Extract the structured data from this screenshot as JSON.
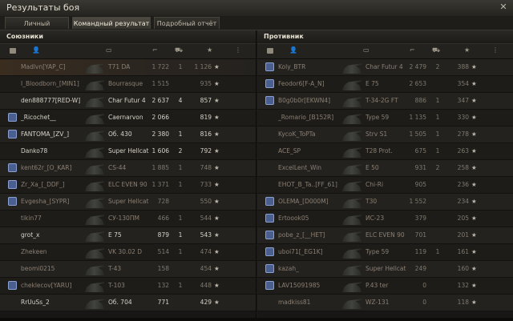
{
  "window": {
    "title": "Результаты боя",
    "close_glyph": "✕"
  },
  "tabs": [
    {
      "label": "Личный результат",
      "active": false
    },
    {
      "label": "Командный результат",
      "active": true
    },
    {
      "label": "Подробный отчёт",
      "active": false
    }
  ],
  "allies": {
    "title": "Союзники",
    "rows": [
      {
        "name": "Madlvn[YAP_C]",
        "vehicle": "T71 DA",
        "damage": "1 722",
        "kills": "1",
        "xp": "1 126",
        "dead": true,
        "highlight": true,
        "clan": false
      },
      {
        "name": "I_Bloodborn_[MIN1]",
        "vehicle": "Bourrasque",
        "damage": "1 515",
        "kills": "",
        "xp": "935",
        "dead": true,
        "highlight": false,
        "clan": false
      },
      {
        "name": "den888777[RED-W]",
        "vehicle": "Char Futur 4",
        "damage": "2 637",
        "kills": "4",
        "xp": "857",
        "dead": false,
        "highlight": false,
        "clan": false
      },
      {
        "name": "_Ricochet__",
        "vehicle": "Caernarvon",
        "damage": "2 066",
        "kills": "",
        "xp": "819",
        "dead": false,
        "highlight": false,
        "clan": true
      },
      {
        "name": "FANTOMA_[ZV_]",
        "vehicle": "Об. 430",
        "damage": "2 380",
        "kills": "1",
        "xp": "816",
        "dead": false,
        "highlight": false,
        "clan": true
      },
      {
        "name": "Danko78",
        "vehicle": "Super Hellcat",
        "damage": "1 606",
        "kills": "2",
        "xp": "792",
        "dead": false,
        "highlight": false,
        "clan": false
      },
      {
        "name": "kent62r_[O_KAR]",
        "vehicle": "CS-44",
        "damage": "1 885",
        "kills": "1",
        "xp": "748",
        "dead": true,
        "highlight": false,
        "clan": true
      },
      {
        "name": "Zr_Xa_[_DDF_]",
        "vehicle": "ELC EVEN 90",
        "damage": "1 371",
        "kills": "1",
        "xp": "733",
        "dead": true,
        "highlight": false,
        "clan": true
      },
      {
        "name": "Evgesha_[SYPR]",
        "vehicle": "Super Hellcat",
        "damage": "728",
        "kills": "",
        "xp": "550",
        "dead": true,
        "highlight": false,
        "clan": true
      },
      {
        "name": "tikin77",
        "vehicle": "СУ-130ПМ",
        "damage": "466",
        "kills": "1",
        "xp": "544",
        "dead": true,
        "highlight": false,
        "clan": false
      },
      {
        "name": "grot_x",
        "vehicle": "E 75",
        "damage": "879",
        "kills": "1",
        "xp": "543",
        "dead": false,
        "highlight": false,
        "clan": false
      },
      {
        "name": "Zhekeen",
        "vehicle": "VK 30.02 D",
        "damage": "514",
        "kills": "1",
        "xp": "474",
        "dead": true,
        "highlight": false,
        "clan": false
      },
      {
        "name": "beomi0215",
        "vehicle": "T-43",
        "damage": "158",
        "kills": "",
        "xp": "454",
        "dead": true,
        "highlight": false,
        "clan": false
      },
      {
        "name": "cheklecov[YARU]",
        "vehicle": "T-103",
        "damage": "132",
        "kills": "1",
        "xp": "448",
        "dead": true,
        "highlight": false,
        "clan": true
      },
      {
        "name": "RrUuSs_2",
        "vehicle": "Об. 704",
        "damage": "771",
        "kills": "",
        "xp": "429",
        "dead": false,
        "highlight": false,
        "clan": false
      }
    ]
  },
  "enemies": {
    "title": "Противник",
    "rows": [
      {
        "name": "Koly_BTR",
        "vehicle": "Char Futur 4",
        "damage": "2 479",
        "kills": "2",
        "xp": "388",
        "dead": true,
        "highlight": false,
        "clan": true
      },
      {
        "name": "Feodor6[F-A_N]",
        "vehicle": "E 75",
        "damage": "2 653",
        "kills": "",
        "xp": "354",
        "dead": true,
        "highlight": false,
        "clan": true
      },
      {
        "name": "B0g0b0r[EKWN4]",
        "vehicle": "T-34-2G FT",
        "damage": "886",
        "kills": "1",
        "xp": "347",
        "dead": true,
        "highlight": false,
        "clan": true
      },
      {
        "name": "_Romario_[B152R]",
        "vehicle": "Type 59",
        "damage": "1 135",
        "kills": "1",
        "xp": "330",
        "dead": true,
        "highlight": false,
        "clan": false
      },
      {
        "name": "KycoK_ToPTa",
        "vehicle": "Strv S1",
        "damage": "1 505",
        "kills": "1",
        "xp": "278",
        "dead": true,
        "highlight": false,
        "clan": false
      },
      {
        "name": "ACE_SP",
        "vehicle": "T28 Prot.",
        "damage": "675",
        "kills": "1",
        "xp": "263",
        "dead": true,
        "highlight": false,
        "clan": false
      },
      {
        "name": "ExcelLent_Win",
        "vehicle": "E 50",
        "damage": "931",
        "kills": "2",
        "xp": "258",
        "dead": true,
        "highlight": false,
        "clan": false
      },
      {
        "name": "EHOT_B_Ta..[FF_61]",
        "vehicle": "Chi-Ri",
        "damage": "905",
        "kills": "",
        "xp": "236",
        "dead": true,
        "highlight": false,
        "clan": false
      },
      {
        "name": "OLEMA_[D000M]",
        "vehicle": "T30",
        "damage": "1 552",
        "kills": "",
        "xp": "234",
        "dead": true,
        "highlight": false,
        "clan": true
      },
      {
        "name": "Ertoook05",
        "vehicle": "ИС-23",
        "damage": "379",
        "kills": "",
        "xp": "205",
        "dead": true,
        "highlight": false,
        "clan": true
      },
      {
        "name": "pobe_z_[__HET]",
        "vehicle": "ELC EVEN 90",
        "damage": "701",
        "kills": "",
        "xp": "201",
        "dead": true,
        "highlight": false,
        "clan": true
      },
      {
        "name": "uboi71[_EG1K]",
        "vehicle": "Type 59",
        "damage": "119",
        "kills": "1",
        "xp": "161",
        "dead": true,
        "highlight": false,
        "clan": true
      },
      {
        "name": "kazah_",
        "vehicle": "Super Hellcat",
        "damage": "249",
        "kills": "",
        "xp": "160",
        "dead": true,
        "highlight": false,
        "clan": true
      },
      {
        "name": "LAV15091985",
        "vehicle": "P.43 ter",
        "damage": "0",
        "kills": "",
        "xp": "132",
        "dead": true,
        "highlight": false,
        "clan": true
      },
      {
        "name": "madkiss81",
        "vehicle": "WZ-131",
        "damage": "0",
        "kills": "",
        "xp": "118",
        "dead": true,
        "highlight": false,
        "clan": false
      }
    ]
  },
  "icons": {
    "platoon": "platoon-icon",
    "player": "player-icon",
    "vehicle": "vehicle-icon",
    "damage": "damage-icon",
    "kills": "kills-icon",
    "xp": "star-icon",
    "options": "menu-icon"
  },
  "colors": {
    "ally_highlight": "#3a2d20",
    "dead_text": "#8a7f72"
  }
}
